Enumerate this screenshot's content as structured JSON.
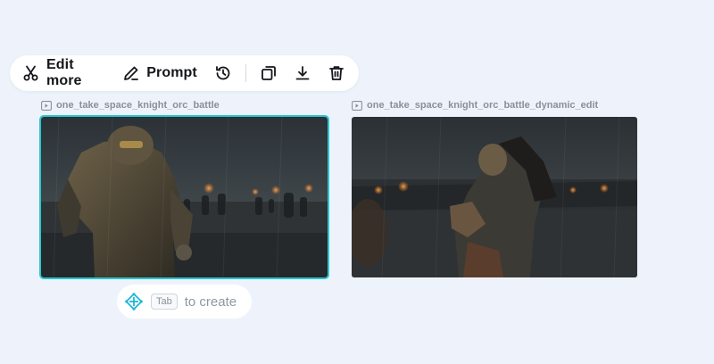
{
  "toolbar": {
    "edit_more_label": "Edit more",
    "prompt_label": "Prompt",
    "icons": [
      "scissors-icon",
      "pen-icon",
      "history-icon",
      "duplicate-icon",
      "download-icon",
      "trash-icon"
    ]
  },
  "cards": [
    {
      "title": "one_take_space_knight_orc_battle",
      "selected": true
    },
    {
      "title": "one_take_space_knight_orc_battle_dynamic_edit",
      "selected": false
    }
  ],
  "tab_hint": {
    "key": "Tab",
    "text": "to create"
  },
  "colors": {
    "background": "#eef3fb",
    "selection": "#27c7d1",
    "create_icon": "#1fb6d9"
  }
}
